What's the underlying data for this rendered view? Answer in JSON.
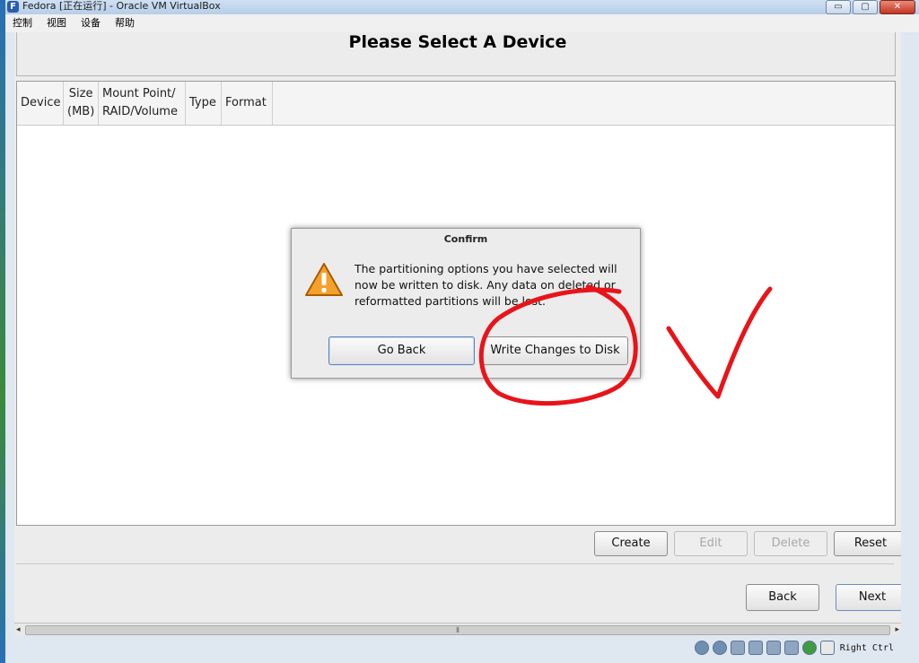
{
  "window": {
    "app_icon_letter": "F",
    "title": "Fedora [正在运行] - Oracle VM VirtualBox",
    "buttons": {
      "minimize": "▭",
      "maximize": "▢",
      "close": "✕"
    }
  },
  "menubar": [
    "控制",
    "视图",
    "设备",
    "帮助"
  ],
  "installer": {
    "page_title": "Please Select A Device",
    "columns": [
      "Device",
      "Size\n(MB)",
      "Mount Point/\nRAID/Volume",
      "Type",
      "Format"
    ],
    "buttons": {
      "create": "Create",
      "edit": "Edit",
      "delete": "Delete",
      "reset": "Reset",
      "back": "Back",
      "next": "Next"
    }
  },
  "dialog": {
    "title": "Confirm",
    "message": "The partitioning options you have selected will now be written to disk.  Any data on deleted or reformatted partitions will be lost.",
    "go_back": "Go Back",
    "write_changes": "Write Changes to Disk"
  },
  "scrollbar": {
    "left": "◂",
    "right": "▸",
    "grip": "⦀",
    "vgrip": "≡"
  },
  "statusbar": {
    "host_key": "Right Ctrl"
  },
  "colors": {
    "annotation": "#e8141a",
    "accent": "#2a5db0"
  }
}
